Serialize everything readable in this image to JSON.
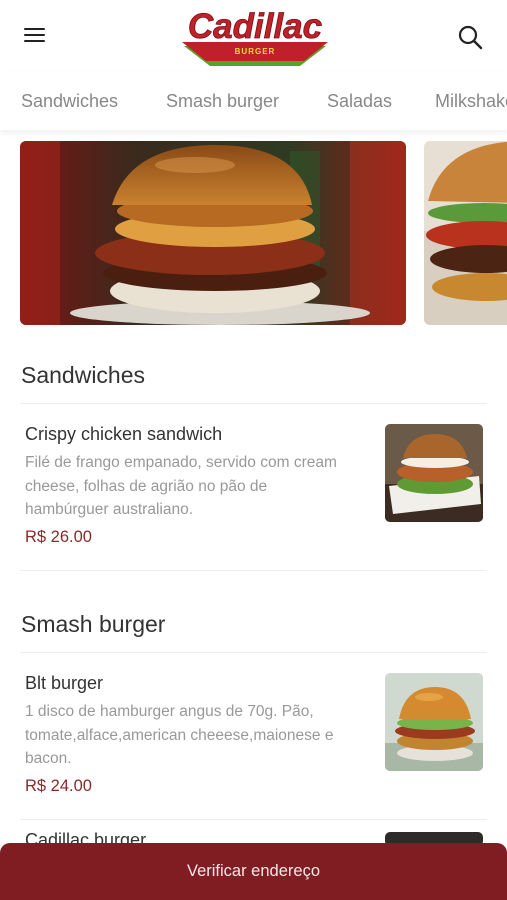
{
  "header": {
    "brand_name": "Cadillac",
    "brand_sub": "BURGER",
    "menu_icon": "hamburger-menu-icon",
    "search_icon": "search-icon"
  },
  "categories": [
    "Sandwiches",
    "Smash burger",
    "Saladas",
    "Milkshakes"
  ],
  "sections": [
    {
      "title": "Sandwiches",
      "items": [
        {
          "name": "Crispy chicken sandwich",
          "desc_lines": [
            "Filé de frango empanado, servido com cream",
            "cheese, folhas de agrião no pão de",
            "hambúrguer australiano."
          ],
          "price": "R$ 26.00"
        }
      ]
    },
    {
      "title": "Smash burger",
      "items": [
        {
          "name": "Blt burger",
          "desc_lines": [
            "1 disco de hamburger angus de 70g. Pão,",
            "tomate,alface,american cheeese,maionese e",
            "bacon."
          ],
          "price": "R$ 24.00"
        },
        {
          "name": "Cadillac burger"
        }
      ]
    }
  ],
  "cta": {
    "label": "Verificar endereço"
  },
  "colors": {
    "brand": "#c0202a",
    "accent": "#7f1d22",
    "price": "#8a2a2a",
    "logo_green": "#5aa02c"
  }
}
